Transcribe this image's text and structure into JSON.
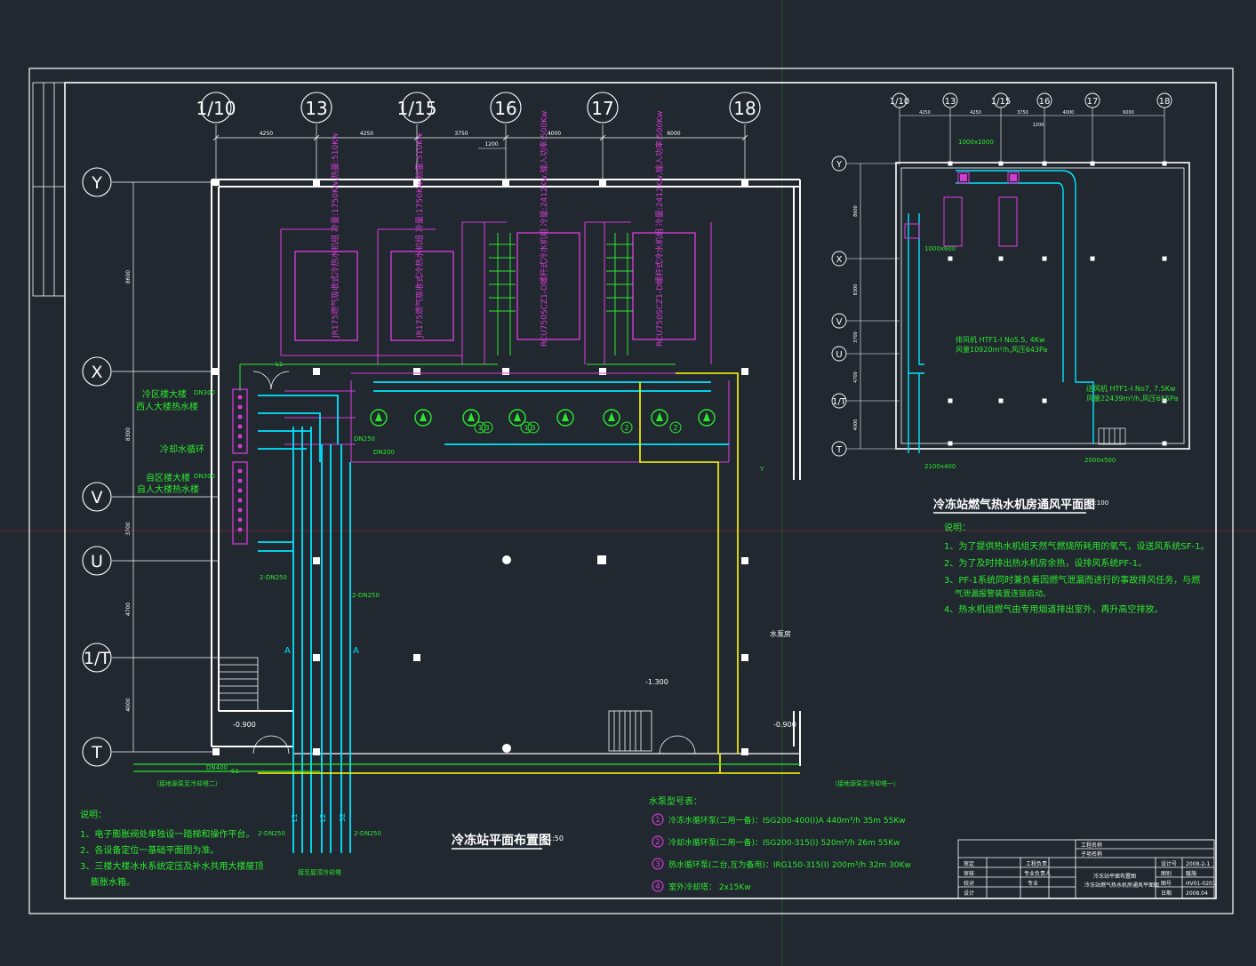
{
  "grid_main": {
    "cols": [
      "1/10",
      "13",
      "1/15",
      "16",
      "17",
      "18"
    ],
    "rows": [
      "Y",
      "X",
      "V",
      "U",
      "1/T",
      "T"
    ],
    "dims_top": [
      "4250",
      "4250",
      "3750",
      "4000",
      "6000"
    ],
    "dim_1200": "1200",
    "dims_left": [
      "8600",
      "8300",
      "3700",
      "4700",
      "4000"
    ]
  },
  "grid_inset": {
    "cols": [
      "1/10",
      "13",
      "1/15",
      "16",
      "17",
      "18"
    ],
    "rows": [
      "Y",
      "X",
      "V",
      "U",
      "1/T",
      "T"
    ],
    "dims_top": [
      "4250",
      "4250",
      "3750",
      "4000",
      "6000"
    ],
    "dim_1200": "1200",
    "dims_left": [
      "8600",
      "8300",
      "3700",
      "4700",
      "4000"
    ]
  },
  "main": {
    "title": "冷冻站平面布置图",
    "scale": "1:50",
    "left_labels": [
      "冷区楼大楼",
      "西人大楼热水楼",
      "冷却水循环",
      "自区楼大楼",
      "自人大楼热水楼"
    ],
    "pump_numbers": [
      "1",
      "1",
      "2",
      "2",
      "3",
      "3"
    ],
    "equipment_vertical": [
      "JR175燃气吸收式冷热水机组 冷量:1750Kw,热量:510Kw",
      "JR175燃气吸收式冷热水机组 冷量:1750Kw,热量:510Kw",
      "RCU750SCZ1-D螺杆式冷水机组 冷量:2412Kw,输入功率:500Kw",
      "RCU750SCZ1-D螺杆式冷水机组 冷量:2412Kw,输入功率:500Kw"
    ],
    "level_marks": [
      "-1.300",
      "-0.900",
      "-0.900"
    ],
    "pipe_labels": [
      "DN300",
      "DN250",
      "DN200",
      "DN400",
      "2-DN250",
      "2-DN250",
      "2-DN250",
      "2-DN250",
      "L1",
      "L2",
      "S1",
      "S2",
      "Y"
    ],
    "section_mark": "A",
    "bottom_notes_side": [
      "（接地源泵至冷却塔二）",
      "（接地源泵至冷却塔一）"
    ],
    "riser_note": "接至屋顶冷却塔",
    "right_room_label": "水泵房",
    "notes_title": "说明：",
    "notes": [
      "1、电子膨胀阀处单独设一踏梯和操作平台。",
      "2、各设备定位一基础平面图为准。",
      "3、三楼大楼冰水系统定压及补水共用大楼屋顶",
      "膨胀水箱。"
    ],
    "pump_table_title": "水泵型号表：",
    "pump_table": [
      {
        "no": "1",
        "text": "冷冻水循环泵(二用一备)：ISG200-400(I)A 440m³/h 35m 55Kw"
      },
      {
        "no": "2",
        "text": "冷却水循环泵(二用一备)：ISG200-315(I) 520m³/h 26m 55Kw"
      },
      {
        "no": "3",
        "text": "热水循环泵(二台,互为备用)：IRG150-315(I) 200m³/h 32m 30Kw"
      },
      {
        "no": "4",
        "text": "室外冷却塔：  2x15Kw"
      }
    ]
  },
  "inset": {
    "title": "冷冻站燃气热水机房通风平面图",
    "scale": "1:100",
    "fan_1": {
      "name": "排风机 HTF1-I No5.5, 4Kw",
      "spec": "风量10920m³/h,风压643Pa"
    },
    "fan_2": {
      "name": "送风机 HTF1-I No7, 7.5Kw",
      "spec": "风量22439m³/h,风压655Pa"
    },
    "duct_labels": [
      "1600x800",
      "1000x600",
      "1250x400",
      "2000x500",
      "2100x400",
      "2000x500",
      "1000x1000"
    ],
    "notes_title": "说明：",
    "notes": [
      "1、为了提供热水机组天然气燃烧所耗用的氧气，设送风系统SF-1。",
      "2、为了及时排出热水机房余热，设排风系统PF-1。",
      "3、PF-1系统同时兼负着因燃气泄漏而进行的事故排风任务，与燃",
      "气泄漏报警装置连锁启动。",
      "4、热水机组燃气由专用烟道排出室外，再升高空排放。"
    ]
  },
  "title_block": {
    "project_name": "工程名称",
    "subproject": "子项名称",
    "drawing_title_1": "冷冻站平面布置图",
    "drawing_title_2": "冷冻站燃气热水机房通风平面图",
    "roles": [
      "审定",
      "审核",
      "校对",
      "设计",
      "工程负责"
    ],
    "roles2": [
      "工程负责",
      "专业负责人",
      "专业"
    ],
    "fields": [
      "设计号",
      "图别",
      "图号",
      "日期"
    ],
    "values": [
      "2008-2-1",
      "暖施",
      "HV01-0201",
      "2008.04"
    ]
  },
  "colors": {
    "background": "#212830",
    "frame": "#ffffff",
    "chilled_water": "#00e5ff",
    "cooling_water": "#ffff00",
    "hot_water": "#ff3cff",
    "text_green": "#2ee82e",
    "magenta": "#d33cd3"
  }
}
